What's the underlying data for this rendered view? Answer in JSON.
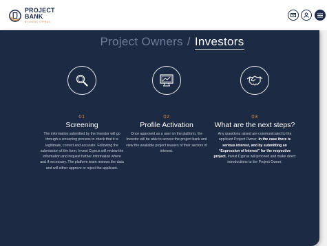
{
  "header": {
    "logo_title": "PROJECT BANK",
    "logo_subtitle": "BY INVEST CYPRUS",
    "icons": [
      "mail-icon",
      "user-icon",
      "menu-icon"
    ],
    "colors": {
      "navy": "#1e2a4a",
      "accent": "#d98a43"
    }
  },
  "tabs": {
    "owners": "Project Owners",
    "separator": "/",
    "investors": "Investors"
  },
  "steps": [
    {
      "icon": "magnifier-icon",
      "number": "01",
      "title": "Screening",
      "body": "The information submitted by the Investor will go through a screening process to check that it is legitimate, correct and accurate. Following the submission of the form, Invest Cyprus will review the information and request further information where and if necessary. The platform team reviews the data and will either approve or reject the applicant."
    },
    {
      "icon": "monitor-chart-icon",
      "number": "02",
      "title": "Profile Activation",
      "body": "Once approved as a user on the platform, the Investor will be able to access the project bank and view the available project teasers of their sectors of interest."
    },
    {
      "icon": "handshake-icon",
      "number": "03",
      "title": "What are the next steps?",
      "body_part1": "Any questions raised are communicated to the applicant Project Owner. ",
      "body_bold": "In the case there is serious interest, and by submitting an “Expression of Interest” for the respective project",
      "body_part2": ", Invest Cyprus will proceed and make direct introductions to the Project Owner."
    }
  ]
}
